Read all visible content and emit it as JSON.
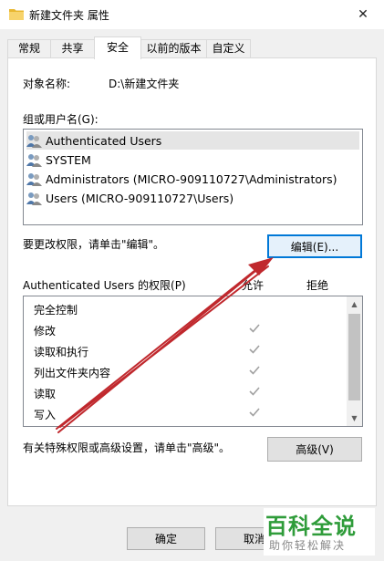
{
  "window": {
    "title": "新建文件夹 属性",
    "close_glyph": "✕"
  },
  "tabs": [
    {
      "label": "常规"
    },
    {
      "label": "共享"
    },
    {
      "label": "安全"
    },
    {
      "label": "以前的版本"
    },
    {
      "label": "自定义"
    }
  ],
  "security": {
    "object_name_label": "对象名称:",
    "object_name_value": "D:\\新建文件夹",
    "group_label": "组或用户名(G):",
    "users": [
      {
        "name": "Authenticated Users"
      },
      {
        "name": "SYSTEM"
      },
      {
        "name": "Administrators (MICRO-909110727\\Administrators)"
      },
      {
        "name": "Users (MICRO-909110727\\Users)"
      }
    ],
    "edit_hint": "要更改权限，请单击\"编辑\"。",
    "edit_button": "编辑(E)...",
    "perm_title": "Authenticated Users 的权限(P)",
    "allow_header": "允许",
    "deny_header": "拒绝",
    "permissions": [
      {
        "name": "完全控制",
        "allow": false
      },
      {
        "name": "修改",
        "allow": true
      },
      {
        "name": "读取和执行",
        "allow": true
      },
      {
        "name": "列出文件夹内容",
        "allow": true
      },
      {
        "name": "读取",
        "allow": true
      },
      {
        "name": "写入",
        "allow": true
      }
    ],
    "advanced_hint": "有关特殊权限或高级设置，请单击\"高级\"。",
    "advanced_button": "高级(V)"
  },
  "footer": {
    "ok_button": "确定",
    "cancel_button": "取消"
  },
  "watermark": {
    "logo_text": "百科全说",
    "sub_text": "助你轻松解决"
  },
  "colors": {
    "accent": "#0078d7",
    "annotation_arrow": "#c0282d",
    "check_gray": "#a0a0a0",
    "watermark_green": "#2f9c3a"
  }
}
